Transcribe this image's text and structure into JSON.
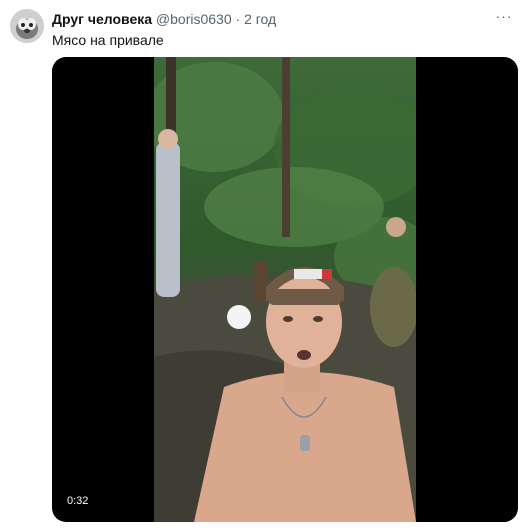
{
  "tweet": {
    "author_name": "Друг человека",
    "author_handle": "@boris0630",
    "separator": "·",
    "time_ago": "2 год",
    "more_icon": "more-horizontal-icon",
    "text": "Мясо на привале"
  },
  "media": {
    "type": "video",
    "duration": "0:32"
  }
}
